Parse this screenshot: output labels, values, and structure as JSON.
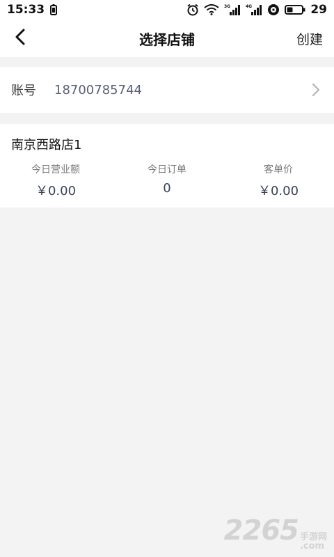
{
  "status_bar": {
    "time": "15:33",
    "battery_level": "29",
    "icons": [
      "battery-saver-icon",
      "alarm-icon",
      "wifi-icon",
      "signal-3g-icon",
      "signal-4g-icon",
      "hd-icon",
      "battery-icon"
    ],
    "network_3g": "3G",
    "network_4g": "4G"
  },
  "nav": {
    "back_icon": "chevron-left-icon",
    "title": "选择店铺",
    "action_label": "创建"
  },
  "account": {
    "label": "账号",
    "value": "18700785744",
    "arrow_icon": "chevron-right-icon"
  },
  "store": {
    "name": "南京西路店1",
    "stats": [
      {
        "label": "今日营业额",
        "value": "￥0.00"
      },
      {
        "label": "今日订单",
        "value": "0"
      },
      {
        "label": "客单价",
        "value": "￥0.00"
      }
    ]
  },
  "watermark": {
    "number": "2265",
    "text": "手游网",
    "domain": ".com"
  },
  "colors": {
    "page_bg": "#f3f3f4",
    "card_bg": "#ffffff",
    "value_text": "#3b4358",
    "label_text": "#7a7a7a",
    "account_value_text": "#5a6076"
  }
}
